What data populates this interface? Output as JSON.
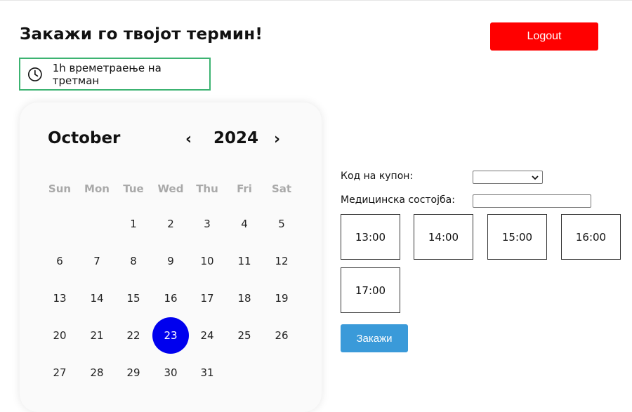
{
  "header": {
    "title": "Закажи го твојот термин!",
    "logout_label": "Logout"
  },
  "duration": {
    "icon": "clock-icon",
    "text": "1h времетраење на третман"
  },
  "calendar": {
    "month": "October",
    "year": "2024",
    "prev_label": "‹",
    "next_label": "›",
    "weekdays": [
      "Sun",
      "Mon",
      "Tue",
      "Wed",
      "Thu",
      "Fri",
      "Sat"
    ],
    "days": [
      "1",
      "2",
      "3",
      "4",
      "5",
      "6",
      "7",
      "8",
      "9",
      "10",
      "11",
      "12",
      "13",
      "14",
      "15",
      "16",
      "17",
      "18",
      "19",
      "20",
      "21",
      "22",
      "23",
      "24",
      "25",
      "26",
      "27",
      "28",
      "29",
      "30",
      "31"
    ],
    "selected_day": "23",
    "selected_color": "#0000ee"
  },
  "form": {
    "coupon_label": "Код на купон:",
    "coupon_value": "",
    "condition_label": "Медицинска состојба:",
    "condition_value": ""
  },
  "slots": [
    "13:00",
    "14:00",
    "15:00",
    "16:00",
    "17:00"
  ],
  "submit_label": "Закажи",
  "colors": {
    "logout": "#ff0000",
    "submit": "#3a9ad9",
    "duration_border": "#3cb371"
  }
}
